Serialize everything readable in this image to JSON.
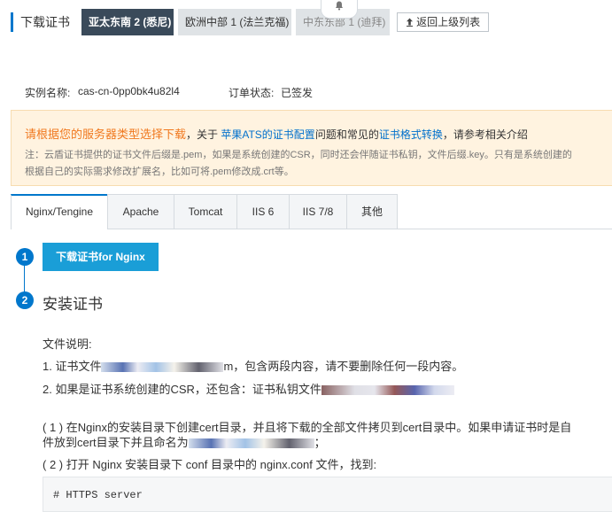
{
  "header": {
    "title": "下载证书",
    "regions": [
      {
        "label": "亚太东南 2 (悉尼)",
        "active": true
      },
      {
        "label": "欧洲中部 1 (法兰克福)",
        "active": false
      },
      {
        "label": "中东东部 1 (迪拜)",
        "active": false
      }
    ],
    "bell_icon": "bell-icon",
    "back_label": "返回上级列表",
    "back_icon": "upload-arrow-icon"
  },
  "info": {
    "instance_label": "实例名称:",
    "instance_value": "cas-cn-0pp0bk4u82l4",
    "status_label": "订单状态:",
    "status_value": "已签发"
  },
  "notice": {
    "strong": "请根据您的服务器类型选择下载",
    "t1": "，关于 ",
    "link1": "苹果ATS的证书配置",
    "t2": "问题和常见的",
    "link2": "证书格式转换",
    "t3": "，请参考相关介绍",
    "line2": "注：云盾证书提供的证书文件后缀是.pem，如果是系统创建的CSR，同时还会伴随证书私钥，文件后缀.key。只有是系统创建的",
    "line3": "根据自己的实际需求修改扩展名，比如可将.pem修改成.crt等。"
  },
  "tabs": [
    "Nginx/Tengine",
    "Apache",
    "Tomcat",
    "IIS 6",
    "IIS 7/8",
    "其他"
  ],
  "steps": {
    "step1_num": "1",
    "step1_button": "下载证书for Nginx",
    "step2_num": "2",
    "step2_title": "安装证书"
  },
  "content": {
    "file_desc": "文件说明:",
    "item1_prefix": "1. 证书文件",
    "item1_suffix": "m，包含两段内容，请不要删除任何一段内容。",
    "item2_prefix": "2. 如果是证书系统创建的CSR，还包含：证书私钥文件",
    "step_a_line1": "( 1 ) 在Nginx的安装目录下创建cert目录，并且将下载的全部文件拷贝到cert目录中。如果申请证书时是自",
    "step_a_line2_prefix": "件放到cert目录下并且命名为",
    "step_a_line2_suffix": "；",
    "step_b": "( 2 ) 打开 Nginx 安装目录下 conf 目录中的 nginx.conf 文件，找到:",
    "code": "# HTTPS server"
  }
}
